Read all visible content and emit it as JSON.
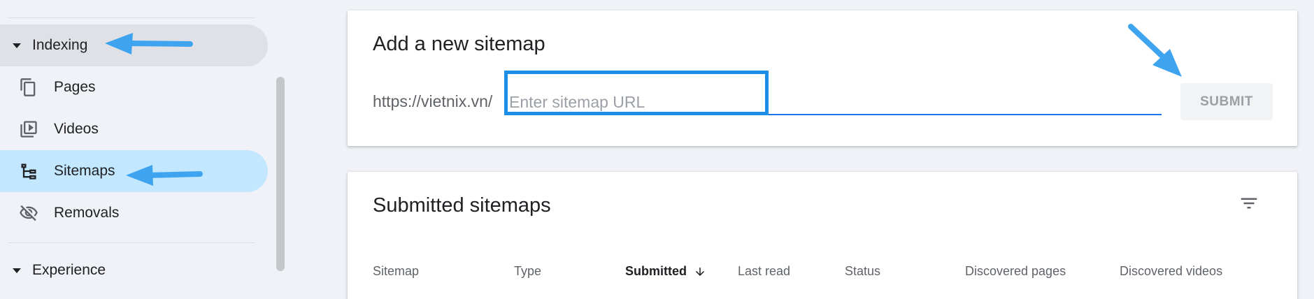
{
  "sidebar": {
    "indexing_label": "Indexing",
    "items": [
      {
        "label": "Pages",
        "icon": "pages-icon"
      },
      {
        "label": "Videos",
        "icon": "videos-icon"
      },
      {
        "label": "Sitemaps",
        "icon": "sitemaps-icon"
      },
      {
        "label": "Removals",
        "icon": "removals-icon"
      }
    ],
    "experience_label": "Experience"
  },
  "add_sitemap": {
    "title": "Add a new sitemap",
    "url_prefix": "https://vietnix.vn/",
    "input_placeholder": "Enter sitemap URL",
    "input_value": "",
    "submit_label": "SUBMIT"
  },
  "submitted_sitemaps": {
    "title": "Submitted sitemaps",
    "columns": [
      "Sitemap",
      "Type",
      "Submitted",
      "Last read",
      "Status",
      "Discovered pages",
      "Discovered videos"
    ],
    "sorted_column": "Submitted"
  },
  "colors": {
    "selected_nav": "#c2e7ff",
    "active_section": "#dfe1e6",
    "annotation_arrow": "#3fa4ef",
    "input_underline": "#1a73e8"
  }
}
